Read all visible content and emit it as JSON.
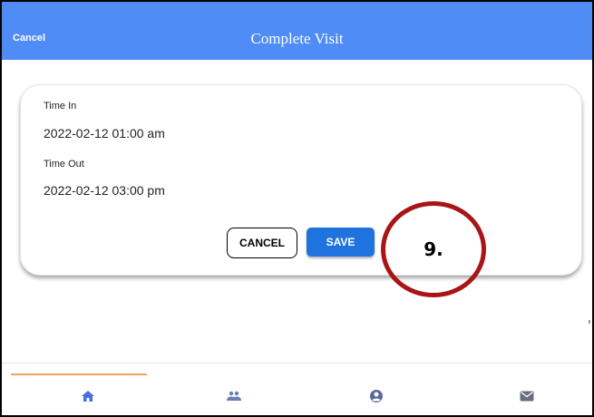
{
  "header": {
    "cancel_label": "Cancel",
    "title": "Complete Visit"
  },
  "form": {
    "time_in_label": "Time In",
    "time_in_value": "2022-02-12 01:00 am",
    "time_out_label": "Time Out",
    "time_out_value": "2022-02-12 03:00 pm",
    "cancel_button": "CANCEL",
    "save_button": "SAVE"
  },
  "annotation": {
    "step_label": "9."
  },
  "tabs": [
    {
      "icon": "home-icon",
      "active": true
    },
    {
      "icon": "people-icon",
      "active": false
    },
    {
      "icon": "account-icon",
      "active": false
    },
    {
      "icon": "mail-icon",
      "active": false
    }
  ],
  "colors": {
    "header": "#4f8cf5",
    "save_button": "#1f73df",
    "tab_icon": "#4a6de0",
    "active_indicator": "#f5a25d",
    "annotation_circle": "#a71516"
  }
}
